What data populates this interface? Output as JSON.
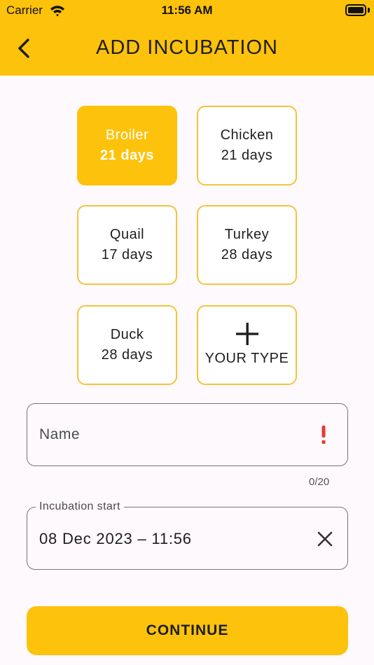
{
  "status_bar": {
    "carrier": "Carrier",
    "time": "11:56 AM"
  },
  "header": {
    "title": "ADD INCUBATION",
    "back_icon": "chevron-left-icon",
    "color": "#fdc20c"
  },
  "types": [
    {
      "name": "Broiler",
      "days": "21 days",
      "selected": true
    },
    {
      "name": "Chicken",
      "days": "21 days",
      "selected": false
    },
    {
      "name": "Quail",
      "days": "17 days",
      "selected": false
    },
    {
      "name": "Turkey",
      "days": "28 days",
      "selected": false
    },
    {
      "name": "Duck",
      "days": "28 days",
      "selected": false
    }
  ],
  "custom_type": {
    "label": "YOUR TYPE",
    "icon": "plus-icon"
  },
  "name_field": {
    "placeholder": "Name",
    "counter": "0/20",
    "error_icon": "exclamation-icon",
    "error_color": "#e53935"
  },
  "start_field": {
    "label": "Incubation start",
    "value": "08 Dec 2023 – 11:56",
    "clear_icon": "close-icon"
  },
  "continue_button": {
    "label": "CONTINUE"
  }
}
